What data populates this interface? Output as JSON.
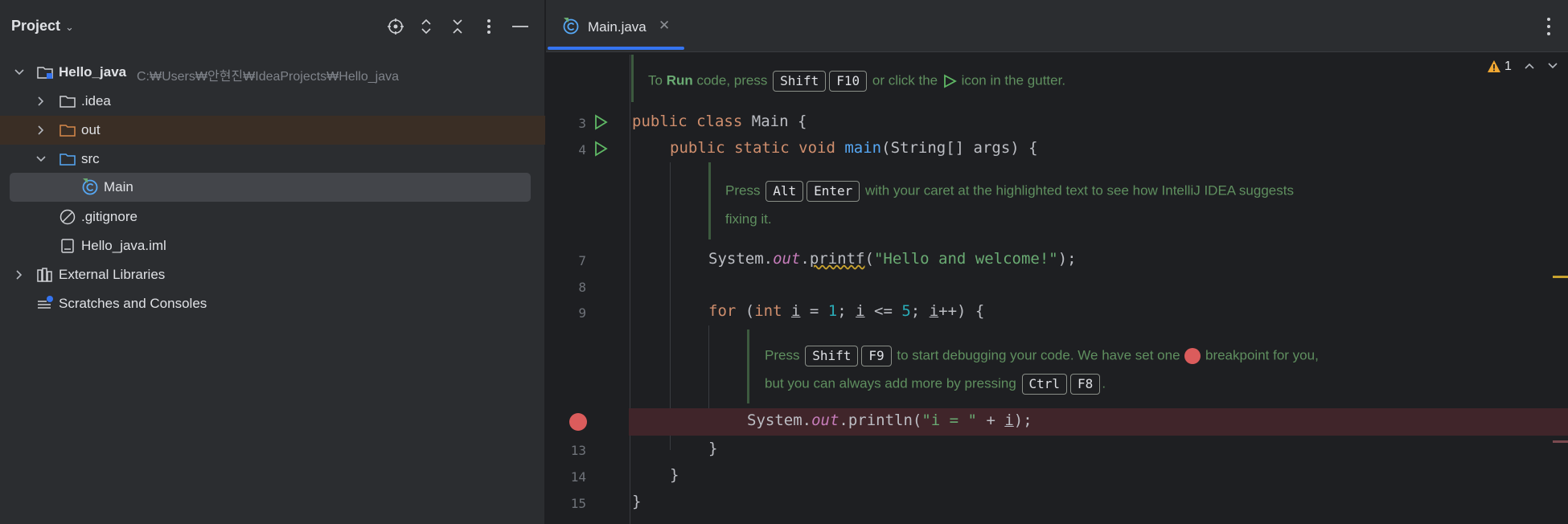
{
  "project_panel": {
    "title": "Project",
    "title_chevron": "⌄",
    "header_icons": [
      "locate-icon",
      "expand-all-icon",
      "collapse-all-icon",
      "more-icon",
      "hide-icon"
    ],
    "tree": [
      {
        "label": "Hello_java",
        "path": "C:₩Users₩안현진₩IdeaProjects₩Hello_java",
        "icon": "module-folder-icon",
        "expanded": true
      },
      {
        "label": ".idea",
        "icon": "folder-icon",
        "expanded": false
      },
      {
        "label": "out",
        "icon": "excluded-folder-icon",
        "expanded": false
      },
      {
        "label": "src",
        "icon": "source-folder-icon",
        "expanded": true
      },
      {
        "label": "Main",
        "icon": "java-class-icon",
        "selected": true
      },
      {
        "label": ".gitignore",
        "icon": "ignore-file-icon"
      },
      {
        "label": "Hello_java.iml",
        "icon": "iml-file-icon"
      },
      {
        "label": "External Libraries",
        "icon": "libraries-icon",
        "expanded": false
      },
      {
        "label": "Scratches and Consoles",
        "icon": "scratches-icon"
      }
    ]
  },
  "editor": {
    "tab": {
      "label": "Main.java",
      "close": "✕"
    },
    "warnings": {
      "count": "1",
      "icon": "warning-icon"
    },
    "hint_run": {
      "pre": "To ",
      "bold": "Run",
      "mid1": " code, press ",
      "key1": "Shift",
      "key2": "F10",
      "post": " or click the ",
      "post2": " icon in the gutter."
    },
    "hint_alt": {
      "pre": "Press ",
      "key1": "Alt",
      "key2": "Enter",
      "post": " with your caret at the highlighted text to see how IntelliJ IDEA suggests",
      "line2": "fixing it."
    },
    "hint_debug": {
      "pre": "Press ",
      "key1": "Shift",
      "key2": "F9",
      "mid": " to start debugging your code. We have set one ",
      "post": " breakpoint for you,",
      "line2pre": "but you can always add more by pressing ",
      "key3": "Ctrl",
      "key4": "F8",
      "line2post": "."
    },
    "line_numbers": {
      "l3": "3",
      "l4": "4",
      "l7": "7",
      "l8": "8",
      "l9": "9",
      "l13": "13",
      "l14": "14",
      "l15": "15"
    },
    "code": {
      "c3_kw1": "public",
      "c3_kw2": "class",
      "c3_name": "Main {",
      "c4_kw": "public static void",
      "c4_fn": "main",
      "c4_rest": "(String[] args) {",
      "c7_a": "System.",
      "c7_out": "out",
      "c7_dot": ".",
      "c7_fn": "printf",
      "c7_p": "(",
      "c7_str": "\"Hello and welcome!\"",
      "c7_end": ");",
      "c9_for": "for",
      "c9_a": " (",
      "c9_int": "int",
      "c9_i1": "i",
      "c9_eq": " = ",
      "c9_one": "1",
      "c9_semi": "; ",
      "c9_i2": "i",
      "c9_le": " <= ",
      "c9_five": "5",
      "c9_semi2": "; ",
      "c9_i3": "i",
      "c9_inc": "++) {",
      "c12_a": "System.",
      "c12_out": "out",
      "c12_b": ".println(",
      "c12_str": "\"i = \"",
      "c12_plus": " + ",
      "c12_i": "i",
      "c12_end": ");",
      "c13": "}",
      "c14": "}",
      "c15": "}"
    }
  }
}
